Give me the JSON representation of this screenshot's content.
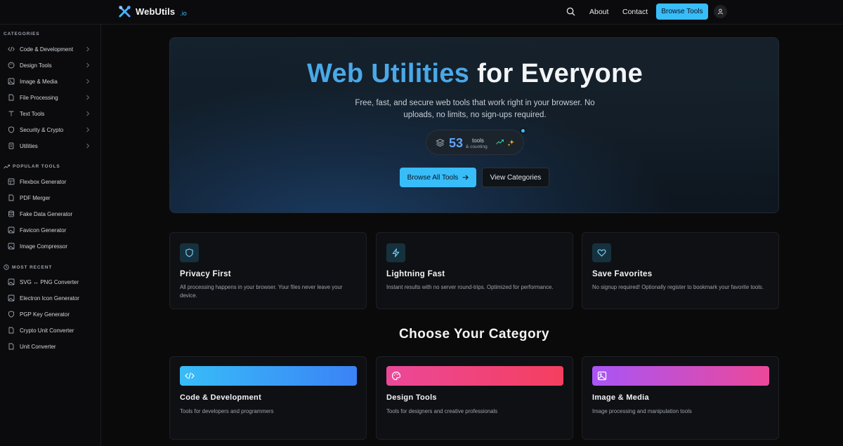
{
  "brand": {
    "name": "WebUtils",
    "tld": ".io",
    "accent": "#38bdf8"
  },
  "nav": {
    "about": "About",
    "contact": "Contact",
    "browse": "Browse Tools"
  },
  "sidebar": {
    "categories_heading": "CATEGORIES",
    "categories": [
      {
        "label": "Code & Development",
        "icon": "code-icon"
      },
      {
        "label": "Design Tools",
        "icon": "palette-icon"
      },
      {
        "label": "Image & Media",
        "icon": "image-icon"
      },
      {
        "label": "File Processing",
        "icon": "file-icon"
      },
      {
        "label": "Text Tools",
        "icon": "text-icon"
      },
      {
        "label": "Security & Crypto",
        "icon": "shield-icon"
      },
      {
        "label": "Utilities",
        "icon": "utilities-icon"
      }
    ],
    "popular_heading": "POPULAR TOOLS",
    "popular": [
      {
        "label": "Flexbox Generator"
      },
      {
        "label": "PDF Merger"
      },
      {
        "label": "Fake Data Generator"
      },
      {
        "label": "Favicon Generator"
      },
      {
        "label": "Image Compressor"
      }
    ],
    "recent_heading": "MOST RECENT",
    "recent": [
      {
        "label": "SVG ↔ PNG Converter"
      },
      {
        "label": "Electron Icon Generator"
      },
      {
        "label": "PGP Key Generator"
      },
      {
        "label": "Crypto Unit Converter"
      },
      {
        "label": "Unit Converter"
      }
    ]
  },
  "hero": {
    "title_highlight": "Web Utilities",
    "title_rest": "for Everyone",
    "subtitle": "Free, fast, and secure web tools that work right in your browser. No uploads, no limits, no sign-ups required.",
    "counter_value": "53",
    "counter_label": "tools",
    "counter_sub": "& counting",
    "primary_button": "Browse All Tools",
    "secondary_button": "View Categories"
  },
  "features": [
    {
      "title": "Privacy First",
      "desc": "All processing happens in your browser. Your files never leave your device.",
      "icon": "shield-icon"
    },
    {
      "title": "Lightning Fast",
      "desc": "Instant results with no server round-trips. Optimized for performance.",
      "icon": "lightning-icon"
    },
    {
      "title": "Save Favorites",
      "desc": "No signup required! Optionally register to bookmark your favorite tools.",
      "icon": "heart-icon"
    }
  ],
  "category_section": {
    "title": "Choose Your Category"
  },
  "category_cards": [
    {
      "title": "Code & Development",
      "desc": "Tools for developers and programmers",
      "icon": "code-icon",
      "gradient": [
        "#38bdf8",
        "#3b82f6"
      ]
    },
    {
      "title": "Design Tools",
      "desc": "Tools for designers and creative professionals",
      "icon": "palette-icon",
      "gradient": [
        "#ec4899",
        "#f43f5e"
      ]
    },
    {
      "title": "Image & Media",
      "desc": "Image processing and manipulation tools",
      "icon": "image-icon",
      "gradient": [
        "#a855f7",
        "#ec4899"
      ]
    }
  ]
}
